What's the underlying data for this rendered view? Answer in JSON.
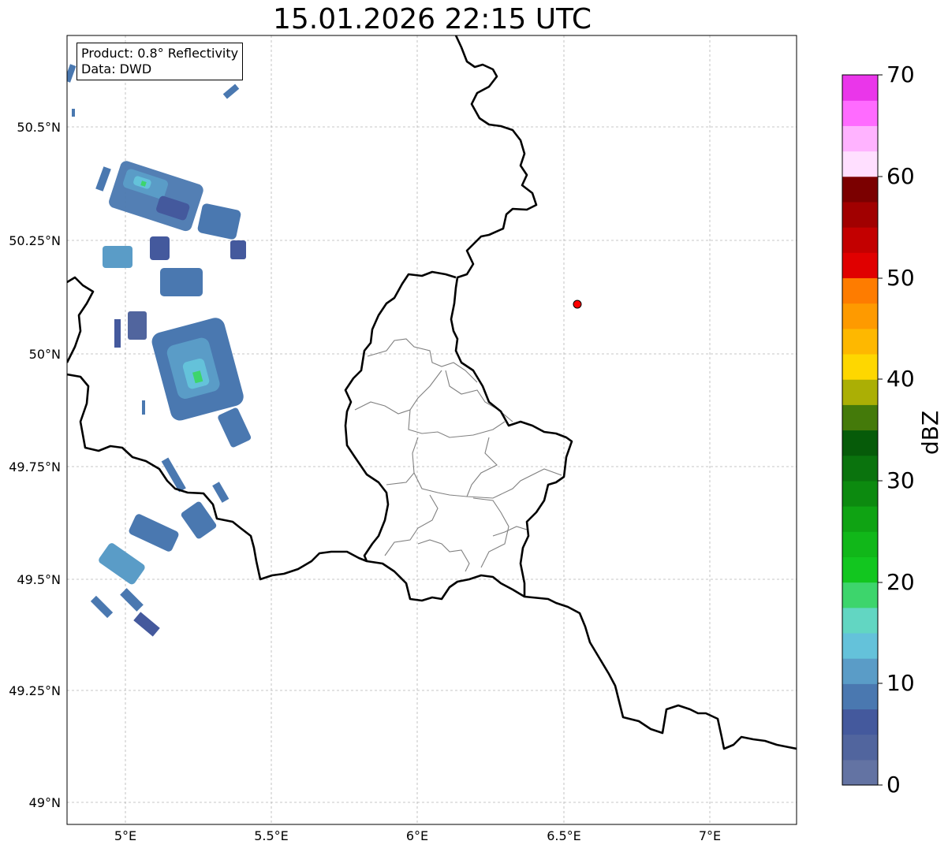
{
  "title": "15.01.2026 22:15 UTC",
  "info": {
    "product": "Product: 0.8° Reflectivity",
    "data": "Data: DWD"
  },
  "axes": {
    "lon_ticks": [
      "5°E",
      "5.5°E",
      "6°E",
      "6.5°E",
      "7°E"
    ],
    "lat_ticks": [
      "50.5°N",
      "50.25°N",
      "50°N",
      "49.75°N",
      "49.5°N",
      "49.25°N",
      "49°N"
    ]
  },
  "colorbar": {
    "unit": "dBZ",
    "tick_labels": [
      "70",
      "60",
      "50",
      "40",
      "30",
      "20",
      "10",
      "0"
    ],
    "colors": [
      "#6373a3",
      "#51659e",
      "#44599d",
      "#4a78b0",
      "#5a9cc7",
      "#64c2da",
      "#62d6c2",
      "#3dd56c",
      "#12c61f",
      "#11b719",
      "#0fa313",
      "#0c8a0f",
      "#0a730d",
      "#065b09",
      "#447a0a",
      "#abaf05",
      "#fed700",
      "#feb800",
      "#fe9a00",
      "#fe7c00",
      "#e00000",
      "#c30000",
      "#a10000",
      "#7b0000",
      "#ffdfff",
      "#ffb3ff",
      "#ff6bff",
      "#ea36ea"
    ]
  },
  "marker": {
    "lon": 6.55,
    "lat": 50.11,
    "color": "#ff0000"
  }
}
